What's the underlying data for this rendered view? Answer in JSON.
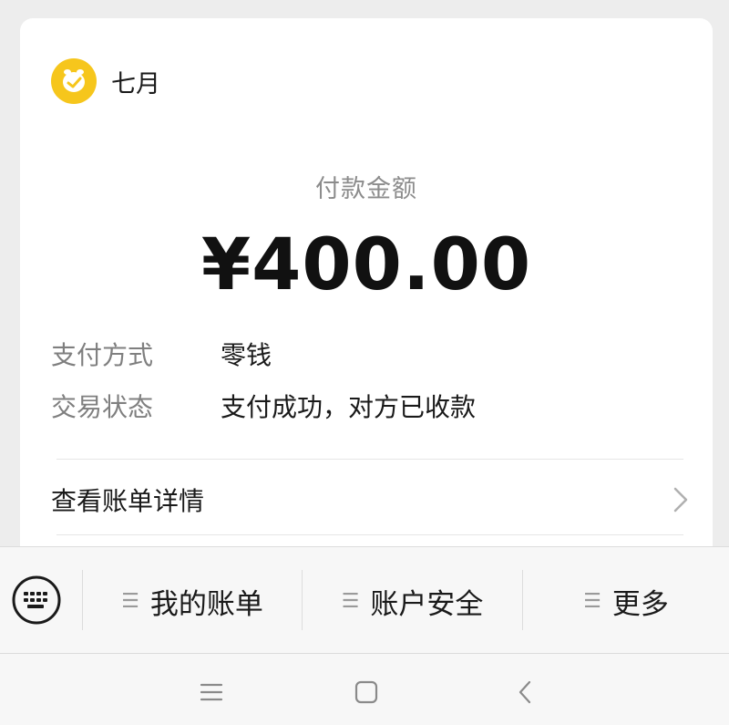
{
  "merchant": {
    "name": "七月",
    "avatar_color": "#f6c61c"
  },
  "payment": {
    "amount_label": "付款金额",
    "amount": "¥400.00",
    "details": [
      {
        "key": "支付方式",
        "value": "零钱"
      },
      {
        "key": "交易状态",
        "value": "支付成功，对方已收款"
      }
    ],
    "bill_link": "查看账单详情"
  },
  "menu": {
    "items": [
      {
        "label": "我的账单"
      },
      {
        "label": "账户安全"
      },
      {
        "label": "更多"
      }
    ]
  },
  "icons": {
    "keyboard": "keyboard-icon",
    "chevron": "chevron-right-icon",
    "nav_menu": "menu-icon",
    "nav_home": "square-home-icon",
    "nav_back": "back-arrow-icon"
  }
}
